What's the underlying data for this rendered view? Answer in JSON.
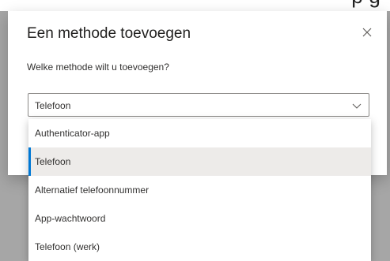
{
  "background_fragment": "p           g",
  "dialog": {
    "title": "Een methode toevoegen",
    "subtitle": "Welke methode wilt u toevoegen?",
    "close_icon": "close-icon"
  },
  "dropdown": {
    "selected_value": "Telefoon",
    "chevron_icon": "chevron-down-icon",
    "options": [
      {
        "label": "Authenticator-app",
        "selected": false
      },
      {
        "label": "Telefoon",
        "selected": true
      },
      {
        "label": "Alternatief telefoonnummer",
        "selected": false
      },
      {
        "label": "App-wachtwoord",
        "selected": false
      },
      {
        "label": "Telefoon (werk)",
        "selected": false
      }
    ]
  },
  "colors": {
    "accent": "#0078d4",
    "overlay": "#a6a6a6",
    "selected_bg": "#edebe9"
  }
}
